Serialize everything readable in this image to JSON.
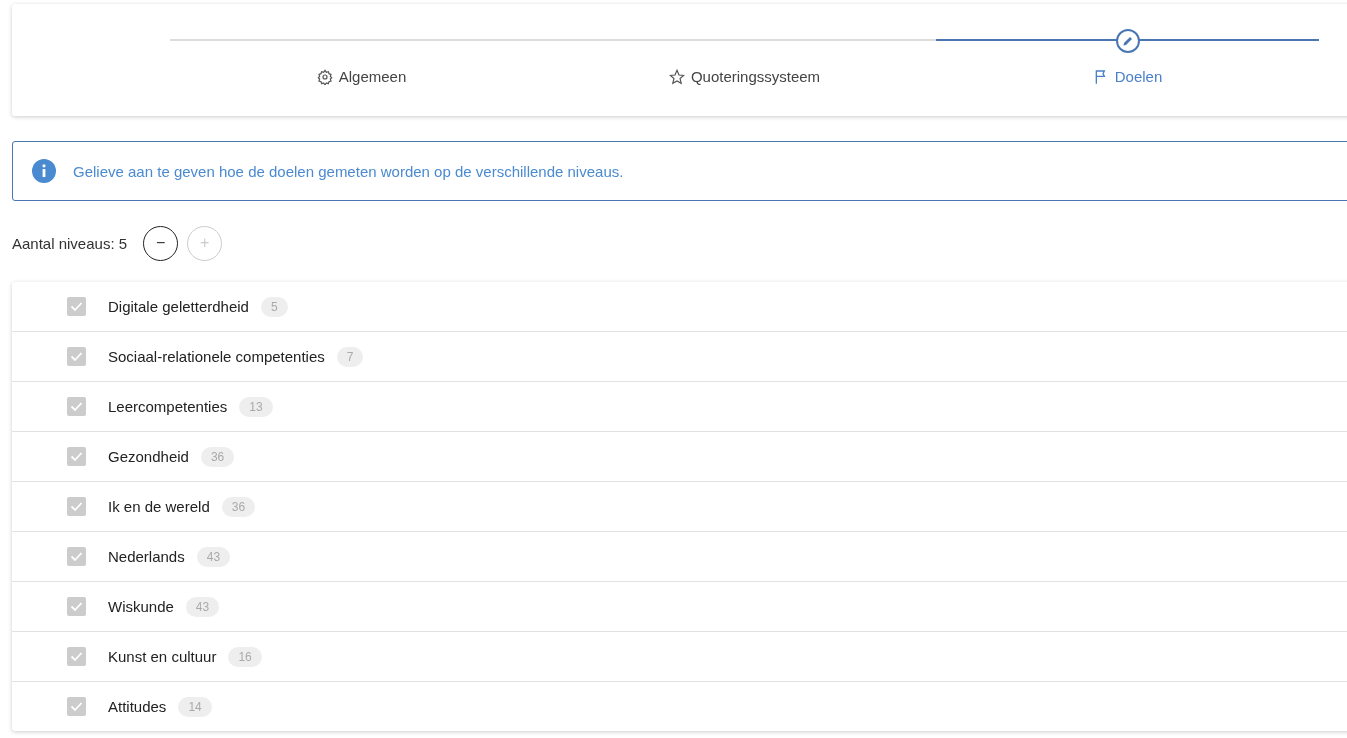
{
  "stepper": {
    "steps": [
      {
        "label": "Algemeen",
        "selected": false
      },
      {
        "label": "Quoteringssysteem",
        "selected": false
      },
      {
        "label": "Doelen",
        "selected": true
      }
    ]
  },
  "info": {
    "text": "Gelieve aan te geven hoe de doelen gemeten worden op de verschillende niveaus."
  },
  "levels": {
    "label": "Aantal niveaus: 5",
    "minus": {
      "label": "−",
      "disabled": false
    },
    "plus": {
      "label": "+",
      "disabled": true
    }
  },
  "goals": [
    {
      "name": "Digitale geletterdheid",
      "count": "5",
      "checked": true,
      "disabled": true
    },
    {
      "name": "Sociaal-relationele competenties",
      "count": "7",
      "checked": true,
      "disabled": true
    },
    {
      "name": "Leercompetenties",
      "count": "13",
      "checked": true,
      "disabled": true
    },
    {
      "name": "Gezondheid",
      "count": "36",
      "checked": true,
      "disabled": true
    },
    {
      "name": "Ik en de wereld",
      "count": "36",
      "checked": true,
      "disabled": true
    },
    {
      "name": "Nederlands",
      "count": "43",
      "checked": true,
      "disabled": true
    },
    {
      "name": "Wiskunde",
      "count": "43",
      "checked": true,
      "disabled": true
    },
    {
      "name": "Kunst en cultuur",
      "count": "16",
      "checked": true,
      "disabled": true
    },
    {
      "name": "Attitudes",
      "count": "14",
      "checked": true,
      "disabled": true
    }
  ]
}
